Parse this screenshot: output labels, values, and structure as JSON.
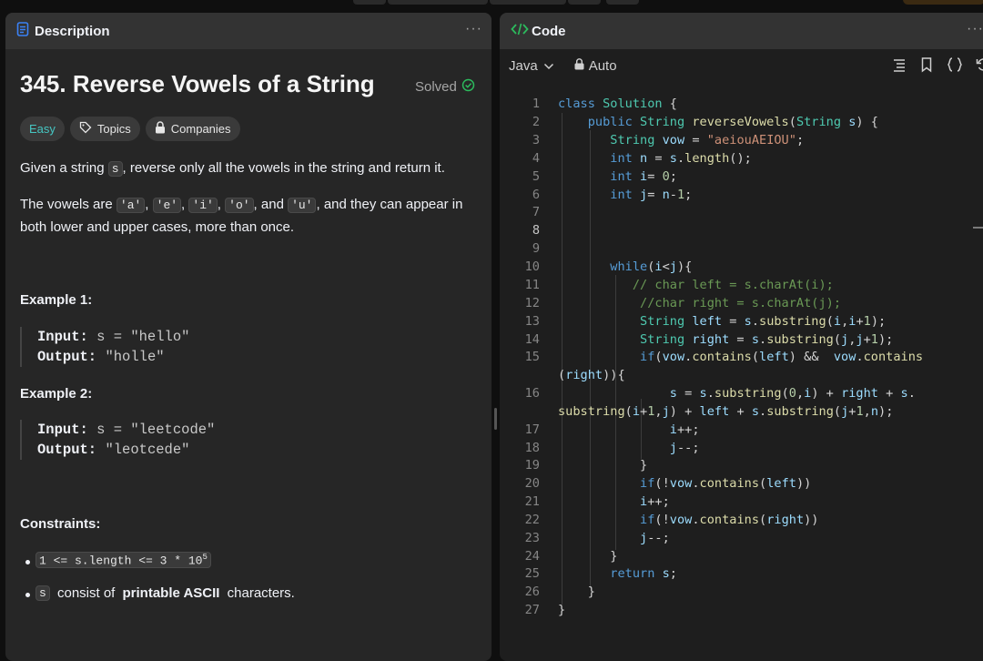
{
  "description_panel": {
    "tab_title": "Description",
    "problem_title": "345. Reverse Vowels of a String",
    "status": "Solved",
    "chips": {
      "difficulty": "Easy",
      "topics": "Topics",
      "companies": "Companies"
    },
    "para1": {
      "before": "Given a string ",
      "code": "s",
      "after": ", reverse only all the vowels in the string and return it."
    },
    "para2": {
      "prefix": "The vowels are ",
      "vowels": [
        "'a'",
        "'e'",
        "'i'",
        "'o'",
        "'u'"
      ],
      "and_word": ", and ",
      "suffix": ", and they can appear in",
      "line2": "both lower and upper cases, more than once."
    },
    "examples": [
      {
        "heading": "Example 1:",
        "input_label": "Input:",
        "input_value": "s = \"hello\"",
        "output_label": "Output:",
        "output_value": "\"holle\""
      },
      {
        "heading": "Example 2:",
        "input_label": "Input:",
        "input_value": "s = \"leetcode\"",
        "output_label": "Output:",
        "output_value": "\"leotcede\""
      }
    ],
    "constraints_heading": "Constraints:",
    "constraints": [
      {
        "code": "1 <= s.length <= 3 * 10",
        "sup": "5"
      },
      {
        "code": "s",
        "pre": " consist of ",
        "bold": "printable ASCII",
        "post": " characters."
      }
    ]
  },
  "code_panel": {
    "tab_title": "Code",
    "language": "Java",
    "mode": "Auto"
  },
  "line_numbers": [
    "1",
    "2",
    "3",
    "4",
    "5",
    "6",
    "7",
    "8",
    "9",
    "10",
    "11",
    "12",
    "13",
    "14",
    "15",
    "16",
    "17",
    "18",
    "19",
    "20",
    "21",
    "22",
    "23",
    "24",
    "25",
    "26",
    "27"
  ],
  "colors": {
    "accent_green": "#2cbb5d",
    "easy": "#46c6c2",
    "code_icon": "#2cbb5d"
  }
}
